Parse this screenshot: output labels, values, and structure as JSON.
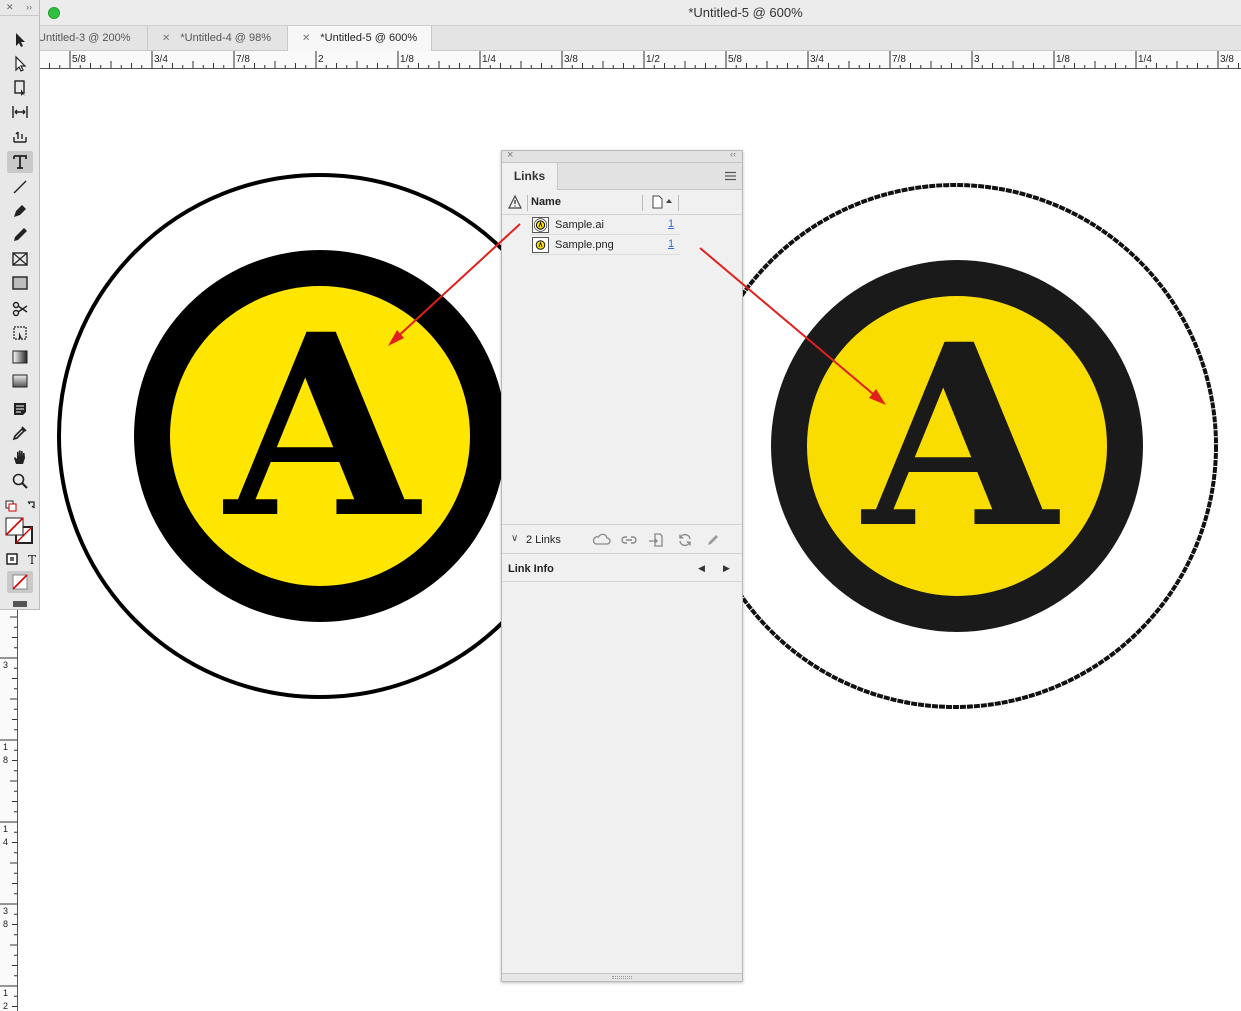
{
  "window": {
    "title": "*Untitled-5 @ 600%"
  },
  "tabs": [
    {
      "label": "Untitled-3 @ 200%",
      "active": false
    },
    {
      "label": "*Untitled-4 @ 98%",
      "active": false
    },
    {
      "label": "*Untitled-5 @ 600%",
      "active": true
    }
  ],
  "hruler": [
    "5/8",
    "3/4",
    "7/8",
    "2",
    "1/8",
    "1/4",
    "3/8",
    "1/2",
    "5/8",
    "3/4",
    "7/8",
    "3",
    "1/8",
    "1/4",
    "3/8"
  ],
  "vruler": [
    "3",
    "1",
    "8",
    "1",
    "4",
    "3",
    "8",
    "1",
    "2"
  ],
  "artwork": {
    "left_letter": "A",
    "right_letter": "A",
    "yellow": "#ffe600",
    "yellow_png": "#f9dd00",
    "black": "#000000",
    "png_black": "#1a1a1a"
  },
  "panel": {
    "tab": "Links",
    "col_name": "Name",
    "links": [
      {
        "name": "Sample.ai",
        "page": "1"
      },
      {
        "name": "Sample.png",
        "page": "1"
      }
    ],
    "count_label": "2 Links",
    "info_label": "Link Info"
  },
  "annotation": {
    "arrow_color": "#e0201b"
  }
}
